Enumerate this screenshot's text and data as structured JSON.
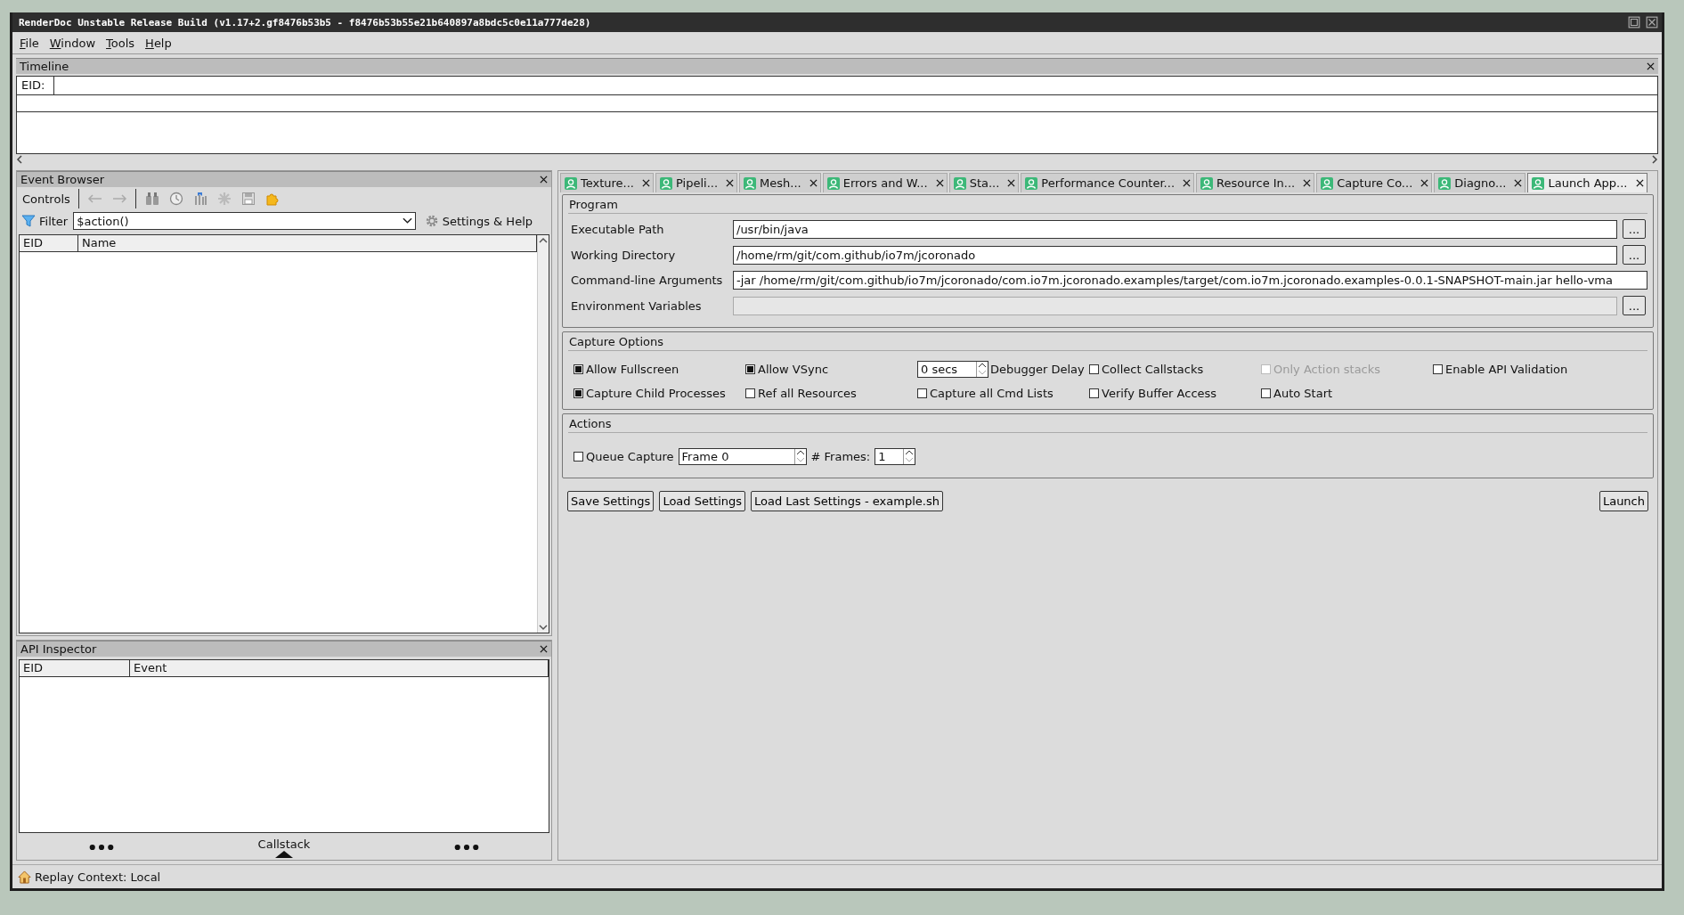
{
  "window": {
    "title": "RenderDoc Unstable Release Build (v1.17+2.gf8476b53b5 - f8476b53b55e21b640897a8bdc5c0e11a777de28)"
  },
  "menu": [
    "File",
    "Window",
    "Tools",
    "Help"
  ],
  "timeline": {
    "title": "Timeline",
    "eid_label": "EID:"
  },
  "event_browser": {
    "title": "Event Browser",
    "controls_label": "Controls",
    "filter_label": "Filter",
    "filter_value": "$action()",
    "settings_label": "Settings & Help",
    "columns": [
      "EID",
      "Name"
    ]
  },
  "api_inspector": {
    "title": "API Inspector",
    "columns": [
      "EID",
      "Event"
    ],
    "callstack_label": "Callstack"
  },
  "tabs": [
    {
      "label": "Texture...",
      "selected": false
    },
    {
      "label": "Pipeli...",
      "selected": false
    },
    {
      "label": "Mesh...",
      "selected": false
    },
    {
      "label": "Errors and W...",
      "selected": false
    },
    {
      "label": "Sta...",
      "selected": false
    },
    {
      "label": "Performance Counter...",
      "selected": false
    },
    {
      "label": "Resource In...",
      "selected": false
    },
    {
      "label": "Capture Co...",
      "selected": false
    },
    {
      "label": "Diagno...",
      "selected": false
    },
    {
      "label": "Launch App...",
      "selected": true
    }
  ],
  "program": {
    "title": "Program",
    "fields": [
      {
        "label": "Executable Path",
        "value": "/usr/bin/java",
        "disabled": false,
        "browse": "..."
      },
      {
        "label": "Working Directory",
        "value": "/home/rm/git/com.github/io7m/jcoronado",
        "disabled": false,
        "browse": "..."
      },
      {
        "label": "Command-line Arguments",
        "value": "-jar /home/rm/git/com.github/io7m/jcoronado/com.io7m.jcoronado.examples/target/com.io7m.jcoronado.examples-0.0.1-SNAPSHOT-main.jar hello-vma",
        "disabled": false
      },
      {
        "label": "Environment Variables",
        "disabled": true,
        "browse": "..."
      }
    ]
  },
  "capture_options": {
    "title": "Capture Options",
    "items": [
      {
        "kind": "checkbox",
        "label": "Allow Fullscreen",
        "checked": true,
        "disabled": false
      },
      {
        "kind": "checkbox",
        "label": "Allow VSync",
        "checked": true,
        "disabled": false
      },
      {
        "kind": "spinbox",
        "value": "0 secs",
        "label": "Debugger Delay"
      },
      {
        "kind": "checkbox",
        "label": "Collect Callstacks",
        "checked": false,
        "disabled": false
      },
      {
        "kind": "checkbox",
        "label": "Only Action stacks",
        "checked": false,
        "disabled": true
      },
      {
        "kind": "checkbox",
        "label": "Enable API Validation",
        "checked": false,
        "disabled": false
      },
      {
        "kind": "checkbox",
        "label": "Capture Child Processes",
        "checked": true,
        "disabled": false
      },
      {
        "kind": "checkbox",
        "label": "Ref all Resources",
        "checked": false,
        "disabled": false
      },
      {
        "kind": "checkbox",
        "label": "Capture all Cmd Lists",
        "checked": false,
        "disabled": false
      },
      {
        "kind": "checkbox",
        "label": "Verify Buffer Access",
        "checked": false,
        "disabled": false
      },
      {
        "kind": "checkbox",
        "label": "Auto Start",
        "checked": false,
        "disabled": false
      }
    ]
  },
  "actions": {
    "title": "Actions",
    "queue_label": "Queue Capture",
    "queue_checked": false,
    "frame_value": "Frame 0",
    "frames_label": "# Frames:",
    "frames_value": "1"
  },
  "buttons": [
    "Save Settings",
    "Load Settings",
    "Load Last Settings - example.sh"
  ],
  "launch_button": "Launch",
  "status_bar": {
    "text": "Replay Context: Local"
  }
}
